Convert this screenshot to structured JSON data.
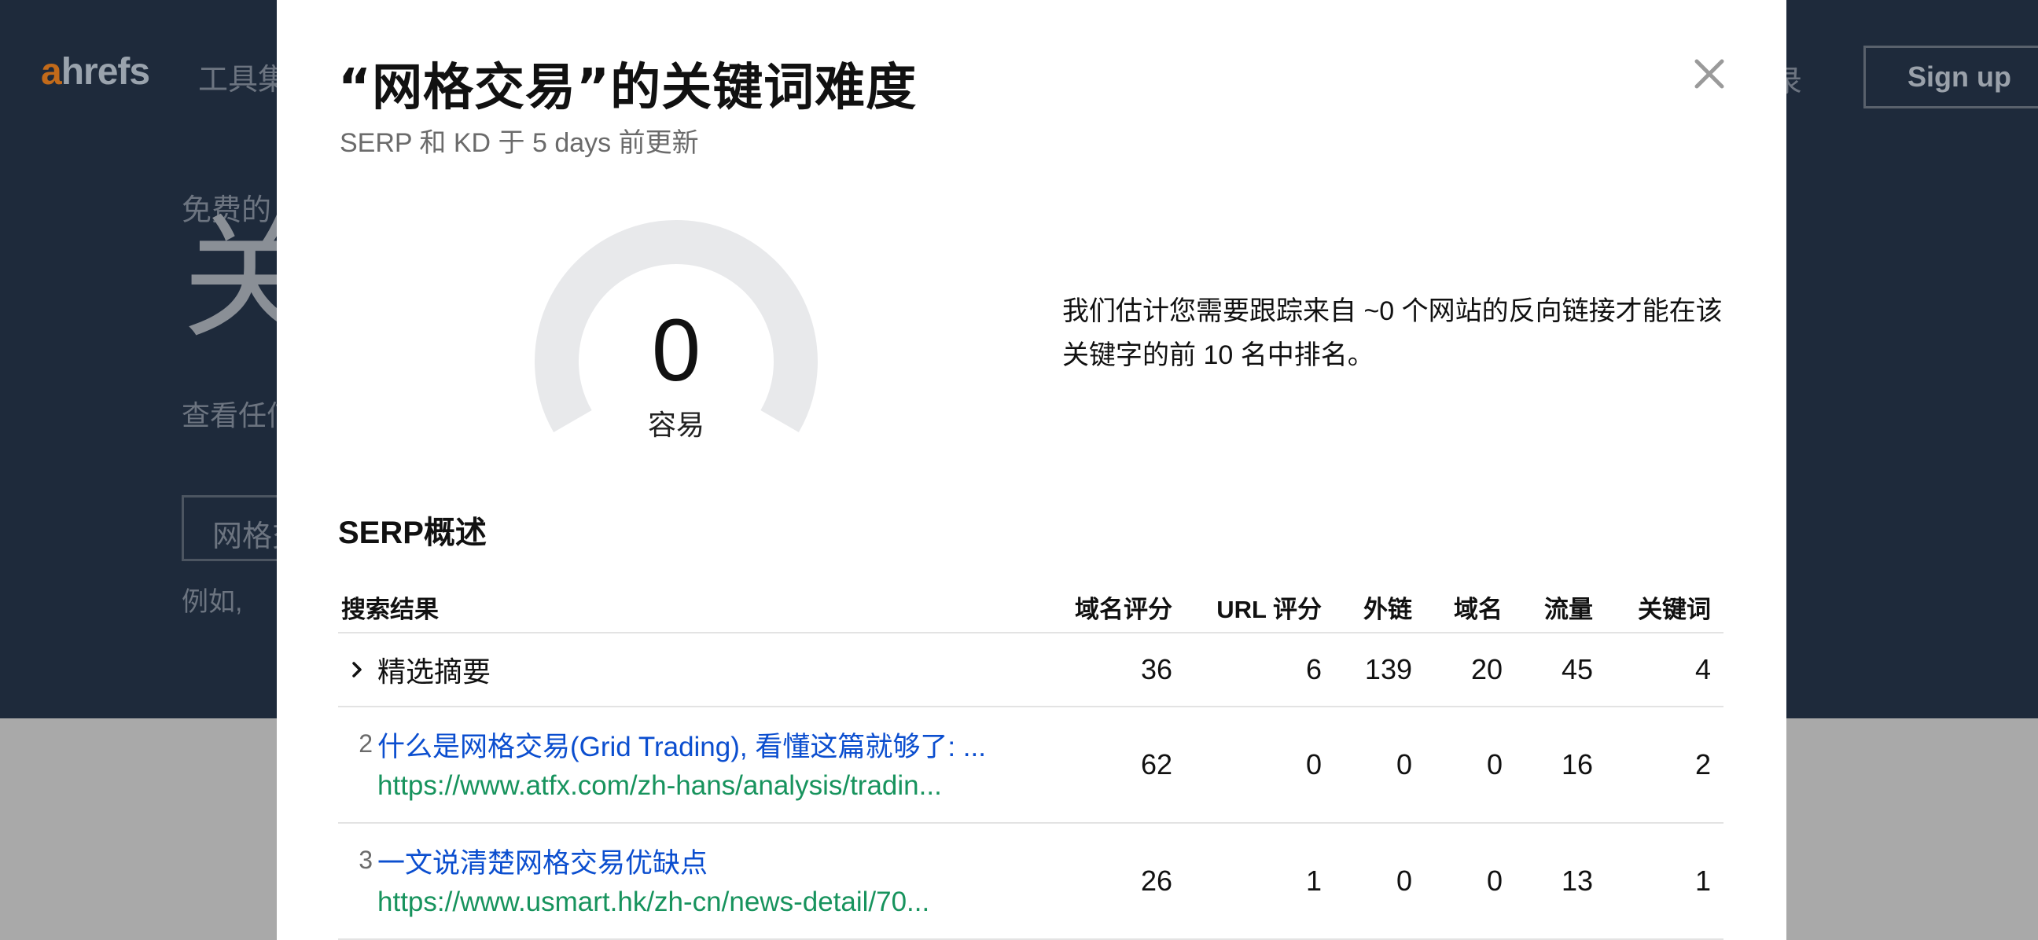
{
  "background": {
    "logo_a": "a",
    "logo_rest": "hrefs",
    "nav_label": "工具集",
    "login_label": "登录",
    "signup_label": "Sign up",
    "kicker": "免费的",
    "big_heading": "关",
    "subtext": "查看任何",
    "input_value": "网格交",
    "example_text": "例如,"
  },
  "modal": {
    "title": "“网格交易”的关键词难度",
    "subtitle": "SERP 和 KD 于 5 days 前更新",
    "close_icon": "close-icon",
    "kd": {
      "value": "0",
      "label": "容易",
      "score_fraction": 0.0
    },
    "estimate_text": "我们估计您需要跟踪来自 ~0 个网站的反向链接才能在该关键字的前 10 名中排名。",
    "serp_title": "SERP概述",
    "table": {
      "headers": [
        "搜索结果",
        "域名评分",
        "URL 评分",
        "外链",
        "域名",
        "流量",
        "关键词"
      ],
      "featured": {
        "label": "精选摘要",
        "dr": "36",
        "ur": "6",
        "backlinks": "139",
        "domains": "20",
        "traffic": "45",
        "keywords": "4"
      },
      "results": [
        {
          "pos": "2",
          "title": "什么是网格交易(Grid Trading), 看懂这篇就够了: ...",
          "url": "https://www.atfx.com/zh-hans/analysis/tradin...",
          "dr": "62",
          "ur": "0",
          "backlinks": "0",
          "domains": "0",
          "traffic": "16",
          "keywords": "2"
        },
        {
          "pos": "3",
          "title": "一文说清楚网格交易优缺点",
          "url": "https://www.usmart.hk/zh-cn/news-detail/70...",
          "dr": "26",
          "ur": "1",
          "backlinks": "0",
          "domains": "0",
          "traffic": "13",
          "keywords": "1"
        }
      ]
    }
  },
  "colors": {
    "link_blue": "#0b4ecf",
    "url_green": "#17935d",
    "gauge_track": "#e8e9eb",
    "overlay_dark": "#1e2a3b",
    "overlay_gray": "#a9a9a9"
  }
}
